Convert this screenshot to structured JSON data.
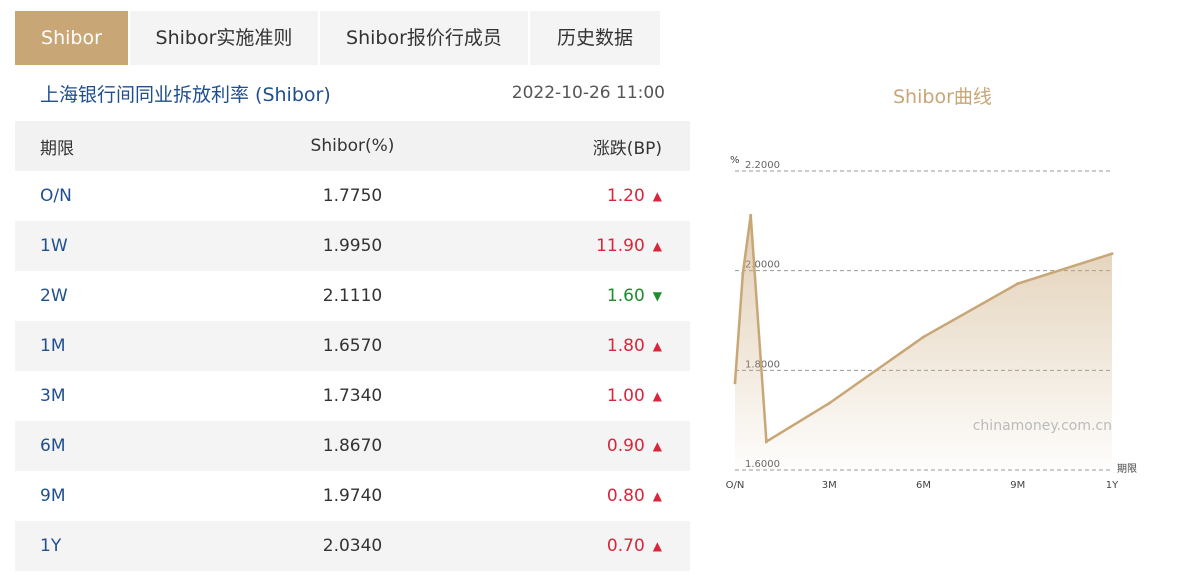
{
  "tabs": [
    {
      "label": "Shibor",
      "active": true
    },
    {
      "label": "Shibor实施准则",
      "active": false
    },
    {
      "label": "Shibor报价行成员",
      "active": false
    },
    {
      "label": "历史数据",
      "active": false
    }
  ],
  "table_title": "上海银行间同业拆放利率 (Shibor)",
  "timestamp": "2022-10-26 11:00",
  "headers": {
    "term": "期限",
    "rate": "Shibor(%)",
    "change": "涨跌(BP)"
  },
  "rows": [
    {
      "term": "O/N",
      "rate": "1.7750",
      "change": "1.20",
      "dir": "up"
    },
    {
      "term": "1W",
      "rate": "1.9950",
      "change": "11.90",
      "dir": "up"
    },
    {
      "term": "2W",
      "rate": "2.1110",
      "change": "1.60",
      "dir": "down"
    },
    {
      "term": "1M",
      "rate": "1.6570",
      "change": "1.80",
      "dir": "up"
    },
    {
      "term": "3M",
      "rate": "1.7340",
      "change": "1.00",
      "dir": "up"
    },
    {
      "term": "6M",
      "rate": "1.8670",
      "change": "0.90",
      "dir": "up"
    },
    {
      "term": "9M",
      "rate": "1.9740",
      "change": "0.80",
      "dir": "up"
    },
    {
      "term": "1Y",
      "rate": "2.0340",
      "change": "0.70",
      "dir": "up"
    }
  ],
  "colors": {
    "accent": "#c8a676",
    "up": "#d9263c",
    "down": "#1e8c2e",
    "link": "#1f4f8f"
  },
  "chart_title": "Shibor曲线",
  "chart_data": {
    "type": "area",
    "x": [
      "O/N",
      "1W",
      "2W",
      "1M",
      "3M",
      "6M",
      "9M",
      "1Y"
    ],
    "values": [
      1.775,
      1.995,
      2.111,
      1.657,
      1.734,
      1.867,
      1.974,
      2.034
    ],
    "x_ticks": [
      "O/N",
      "3M",
      "6M",
      "9M",
      "1Y"
    ],
    "y_ticks": [
      "2.2000",
      "2.0000",
      "1.8000",
      "1.6000"
    ],
    "ylim": [
      1.6,
      2.2
    ],
    "xlabel": "期限",
    "ylabel": "%",
    "watermark": "chinamoney.com.cn",
    "grid": true
  }
}
